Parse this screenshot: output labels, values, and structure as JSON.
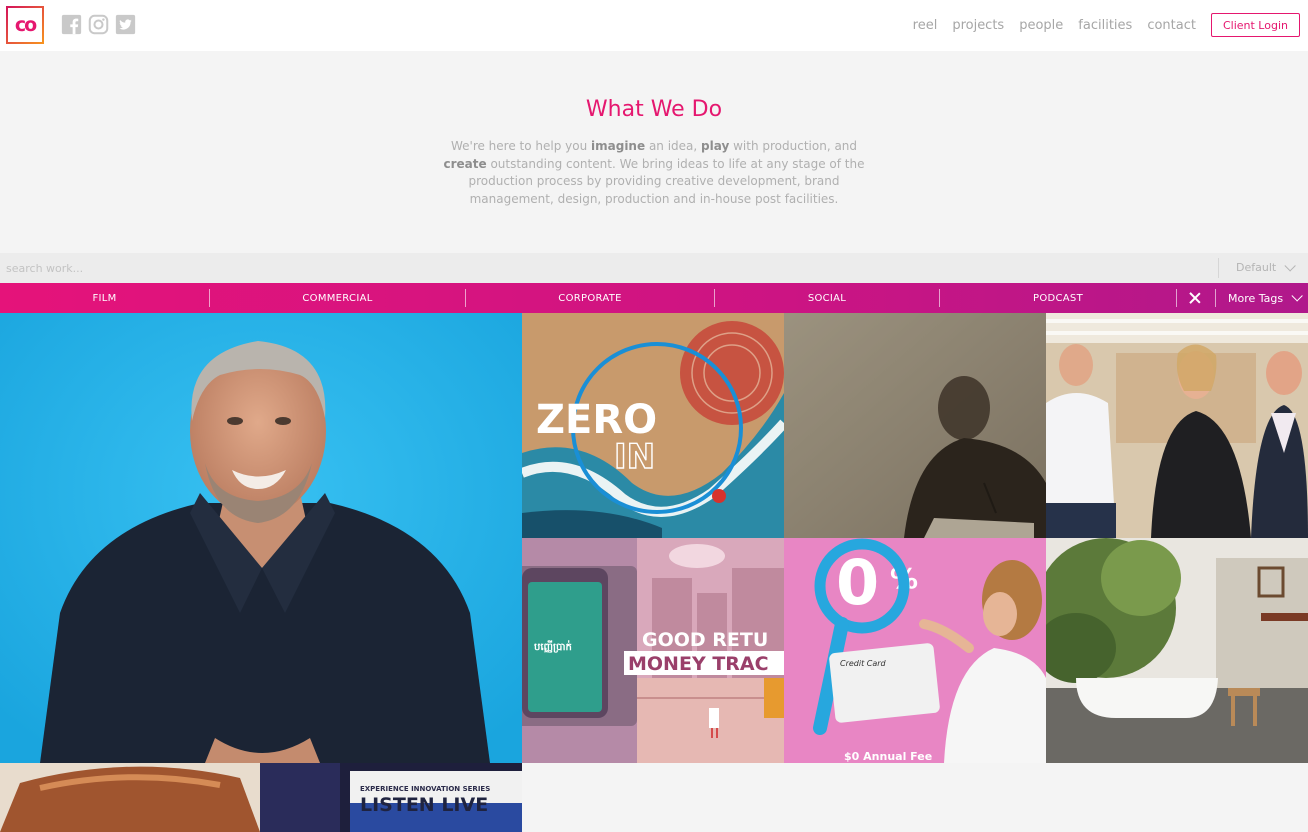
{
  "header": {
    "logo_text": "co",
    "social": [
      "facebook-icon",
      "instagram-icon",
      "twitter-icon"
    ],
    "nav": [
      "reel",
      "projects",
      "people",
      "facilities",
      "contact"
    ],
    "client_login": "Client Login"
  },
  "intro": {
    "title": "What We Do",
    "text_1": "We're here to help you ",
    "bold_1": "imagine",
    "text_2": " an idea, ",
    "bold_2": "play",
    "text_3": " with production, and ",
    "bold_3": "create",
    "text_4": " outstanding content. We bring ideas to life at any stage of the production process by providing creative development, brand management, design, production and in-house post facilities."
  },
  "search": {
    "placeholder": "search work...",
    "sort_value": "Default"
  },
  "tags": {
    "items": [
      "FILM",
      "COMMERCIAL",
      "CORPORATE",
      "SOCIAL",
      "PODCAST"
    ],
    "more_label": "More Tags"
  },
  "tiles": {
    "zero_in": {
      "line1": "ZERO",
      "line2": "IN"
    },
    "money_tracker": {
      "app_text": "បញ្ញើប្រាក់",
      "line1": "GOOD RETU",
      "line2": "MONEY TRAC"
    },
    "credit": {
      "big": "0",
      "pct": "%",
      "card_label": "Credit Card",
      "caption": "$0 Annual Fee"
    },
    "listen_live": {
      "small": "EXPERIENCE INNOVATION SERIES",
      "big": "LISTEN LIVE"
    }
  },
  "colors": {
    "accent": "#e5176f",
    "tag_gradient_start": "#e5137a",
    "tag_gradient_end": "#b0188b",
    "muted_text": "#a6a6a6"
  }
}
